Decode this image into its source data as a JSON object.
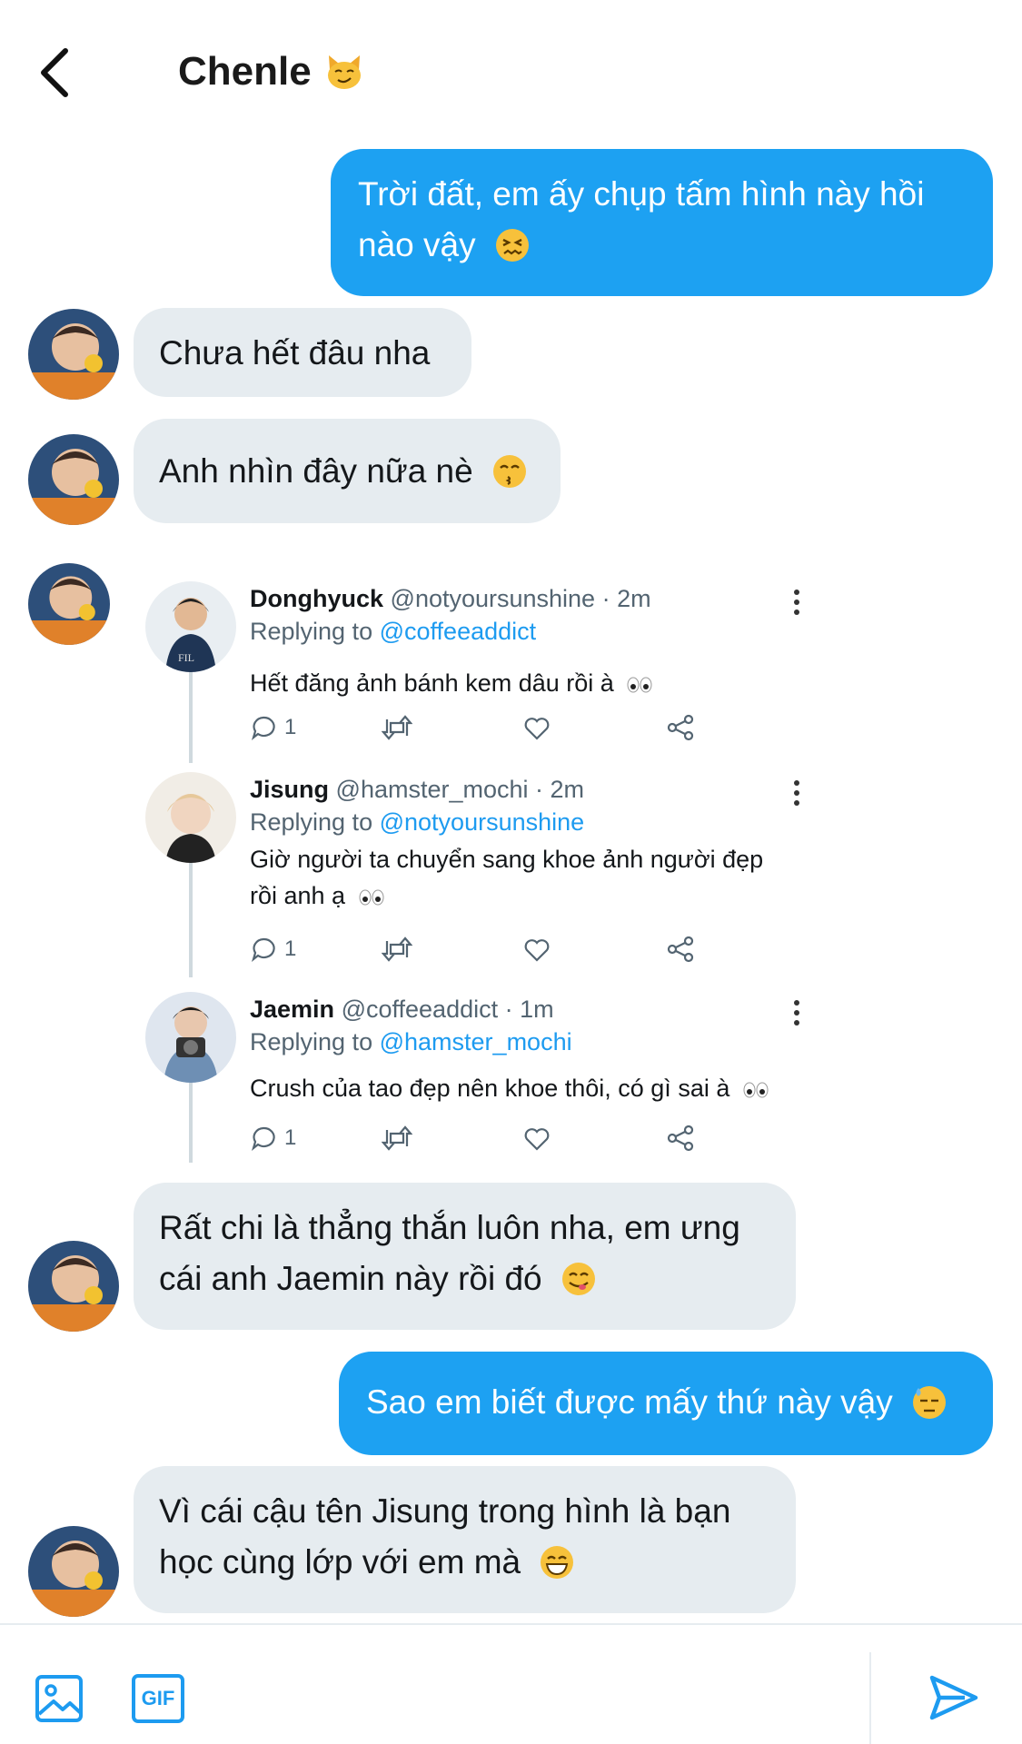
{
  "header": {
    "back_icon": "chevron-left-icon",
    "title": "Chenle",
    "title_emoji": "cat-smirk-emoji"
  },
  "colors": {
    "outgoing_bubble": "#1da1f2",
    "incoming_bubble": "#e6ecf0",
    "link": "#1d9bf0",
    "muted": "#536471"
  },
  "messages": [
    {
      "direction": "out",
      "text": "Trời đất, em ấy chụp tấm hình này hồi nào vậy",
      "emoji": "confounded-face"
    },
    {
      "direction": "in",
      "text": "Chưa hết đâu nha"
    },
    {
      "direction": "in",
      "text": "Anh nhìn đây nữa nè",
      "emoji": "kissing-face"
    },
    {
      "direction": "in",
      "text": "Rất chi là thẳng thắn luôn nha, em ưng cái anh Jaemin này rồi đó",
      "emoji": "yum-face"
    },
    {
      "direction": "out",
      "text": "Sao em biết được mấy thứ này vậy",
      "emoji": "sweat-face"
    },
    {
      "direction": "in",
      "text": "Vì cái cậu tên Jisung trong hình là bạn học cùng lớp với em mà",
      "emoji": "grin-face"
    }
  ],
  "shared_thread": [
    {
      "name": "Donghyuck",
      "handle": "@notyoursunshine",
      "time": "· 2m",
      "replying_label": "Replying to",
      "replying_to": "@coffeeaddict",
      "text": "Hết đăng ảnh bánh kem dâu rồi à",
      "reply_count": "1"
    },
    {
      "name": "Jisung",
      "handle": "@hamster_mochi",
      "time": "· 2m",
      "replying_label": "Replying to",
      "replying_to": "@notyoursunshine",
      "text": "Giờ người ta chuyển sang khoe ảnh người đẹp rồi anh ạ",
      "reply_count": "1"
    },
    {
      "name": "Jaemin",
      "handle": "@coffeeaddict",
      "time": "· 1m",
      "replying_label": "Replying to",
      "replying_to": "@hamster_mochi",
      "text": "Crush của tao đẹp nên khoe thôi, có gì sai à",
      "reply_count": "1"
    }
  ],
  "composer": {
    "image_icon": "image-icon",
    "gif_label": "GIF",
    "send_icon": "send-icon"
  }
}
